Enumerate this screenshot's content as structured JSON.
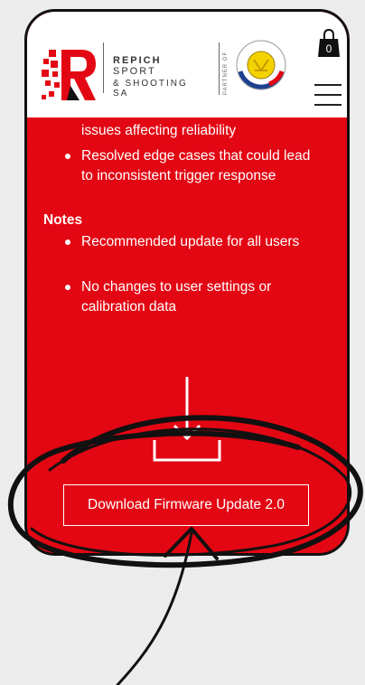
{
  "header": {
    "brand_bold": "REPICH",
    "brand_light": "SPORT",
    "brand_line2": "& SHOOTING SA",
    "partner_label": "PARTNER OF",
    "cart_count": "0"
  },
  "content": {
    "fragment_line": "issues affecting reliability",
    "bullets_top": [
      "Resolved edge cases that could lead to inconsistent trigger response"
    ],
    "notes_heading": "Notes",
    "notes_bullets": [
      "Recommended update for all users",
      "No changes to user settings or calibration data"
    ],
    "download_button_label": "Download Firmware Update 2.0"
  },
  "colors": {
    "brand_red": "#e30613",
    "header_bg": "#ffffff",
    "page_bg": "#ececec"
  }
}
